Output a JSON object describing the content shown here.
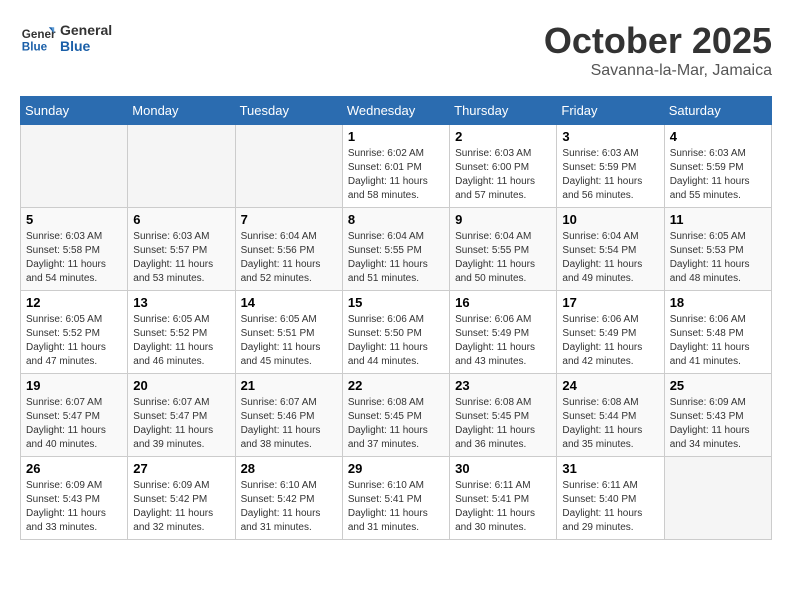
{
  "header": {
    "logo_general": "General",
    "logo_blue": "Blue",
    "month": "October 2025",
    "location": "Savanna-la-Mar, Jamaica"
  },
  "days_of_week": [
    "Sunday",
    "Monday",
    "Tuesday",
    "Wednesday",
    "Thursday",
    "Friday",
    "Saturday"
  ],
  "weeks": [
    [
      {
        "day": null
      },
      {
        "day": null
      },
      {
        "day": null
      },
      {
        "day": "1",
        "sunrise": "6:02 AM",
        "sunset": "6:01 PM",
        "daylight": "11 hours and 58 minutes."
      },
      {
        "day": "2",
        "sunrise": "6:03 AM",
        "sunset": "6:00 PM",
        "daylight": "11 hours and 57 minutes."
      },
      {
        "day": "3",
        "sunrise": "6:03 AM",
        "sunset": "5:59 PM",
        "daylight": "11 hours and 56 minutes."
      },
      {
        "day": "4",
        "sunrise": "6:03 AM",
        "sunset": "5:59 PM",
        "daylight": "11 hours and 55 minutes."
      }
    ],
    [
      {
        "day": "5",
        "sunrise": "6:03 AM",
        "sunset": "5:58 PM",
        "daylight": "11 hours and 54 minutes."
      },
      {
        "day": "6",
        "sunrise": "6:03 AM",
        "sunset": "5:57 PM",
        "daylight": "11 hours and 53 minutes."
      },
      {
        "day": "7",
        "sunrise": "6:04 AM",
        "sunset": "5:56 PM",
        "daylight": "11 hours and 52 minutes."
      },
      {
        "day": "8",
        "sunrise": "6:04 AM",
        "sunset": "5:55 PM",
        "daylight": "11 hours and 51 minutes."
      },
      {
        "day": "9",
        "sunrise": "6:04 AM",
        "sunset": "5:55 PM",
        "daylight": "11 hours and 50 minutes."
      },
      {
        "day": "10",
        "sunrise": "6:04 AM",
        "sunset": "5:54 PM",
        "daylight": "11 hours and 49 minutes."
      },
      {
        "day": "11",
        "sunrise": "6:05 AM",
        "sunset": "5:53 PM",
        "daylight": "11 hours and 48 minutes."
      }
    ],
    [
      {
        "day": "12",
        "sunrise": "6:05 AM",
        "sunset": "5:52 PM",
        "daylight": "11 hours and 47 minutes."
      },
      {
        "day": "13",
        "sunrise": "6:05 AM",
        "sunset": "5:52 PM",
        "daylight": "11 hours and 46 minutes."
      },
      {
        "day": "14",
        "sunrise": "6:05 AM",
        "sunset": "5:51 PM",
        "daylight": "11 hours and 45 minutes."
      },
      {
        "day": "15",
        "sunrise": "6:06 AM",
        "sunset": "5:50 PM",
        "daylight": "11 hours and 44 minutes."
      },
      {
        "day": "16",
        "sunrise": "6:06 AM",
        "sunset": "5:49 PM",
        "daylight": "11 hours and 43 minutes."
      },
      {
        "day": "17",
        "sunrise": "6:06 AM",
        "sunset": "5:49 PM",
        "daylight": "11 hours and 42 minutes."
      },
      {
        "day": "18",
        "sunrise": "6:06 AM",
        "sunset": "5:48 PM",
        "daylight": "11 hours and 41 minutes."
      }
    ],
    [
      {
        "day": "19",
        "sunrise": "6:07 AM",
        "sunset": "5:47 PM",
        "daylight": "11 hours and 40 minutes."
      },
      {
        "day": "20",
        "sunrise": "6:07 AM",
        "sunset": "5:47 PM",
        "daylight": "11 hours and 39 minutes."
      },
      {
        "day": "21",
        "sunrise": "6:07 AM",
        "sunset": "5:46 PM",
        "daylight": "11 hours and 38 minutes."
      },
      {
        "day": "22",
        "sunrise": "6:08 AM",
        "sunset": "5:45 PM",
        "daylight": "11 hours and 37 minutes."
      },
      {
        "day": "23",
        "sunrise": "6:08 AM",
        "sunset": "5:45 PM",
        "daylight": "11 hours and 36 minutes."
      },
      {
        "day": "24",
        "sunrise": "6:08 AM",
        "sunset": "5:44 PM",
        "daylight": "11 hours and 35 minutes."
      },
      {
        "day": "25",
        "sunrise": "6:09 AM",
        "sunset": "5:43 PM",
        "daylight": "11 hours and 34 minutes."
      }
    ],
    [
      {
        "day": "26",
        "sunrise": "6:09 AM",
        "sunset": "5:43 PM",
        "daylight": "11 hours and 33 minutes."
      },
      {
        "day": "27",
        "sunrise": "6:09 AM",
        "sunset": "5:42 PM",
        "daylight": "11 hours and 32 minutes."
      },
      {
        "day": "28",
        "sunrise": "6:10 AM",
        "sunset": "5:42 PM",
        "daylight": "11 hours and 31 minutes."
      },
      {
        "day": "29",
        "sunrise": "6:10 AM",
        "sunset": "5:41 PM",
        "daylight": "11 hours and 31 minutes."
      },
      {
        "day": "30",
        "sunrise": "6:11 AM",
        "sunset": "5:41 PM",
        "daylight": "11 hours and 30 minutes."
      },
      {
        "day": "31",
        "sunrise": "6:11 AM",
        "sunset": "5:40 PM",
        "daylight": "11 hours and 29 minutes."
      },
      {
        "day": null
      }
    ]
  ]
}
